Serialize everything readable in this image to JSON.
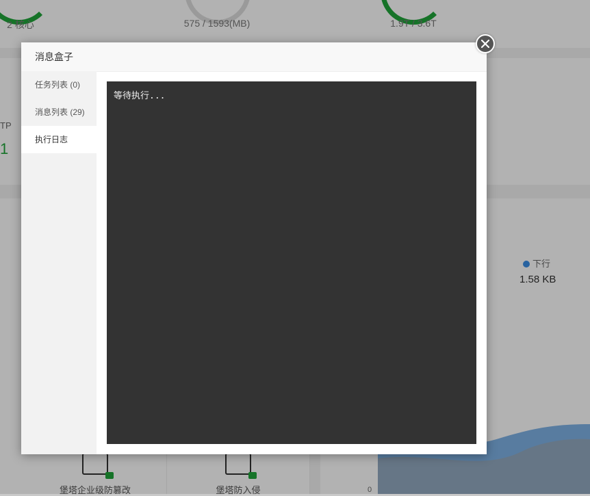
{
  "background": {
    "cpu_label": "2 核心",
    "memory_label": "575 / 1593(MB)",
    "disk_label": "1.9T / 3.6T",
    "partial_left_label": "TP",
    "partial_left_value": "1",
    "legend_down_label": "下行",
    "down_value": "1.58 KB",
    "feature1_label": "堡塔企业级防篡改",
    "feature2_label": "堡塔防入侵",
    "chart_axis_zero": "0",
    "colors": {
      "accent_green": "#20a53a",
      "series_blue": "#3a8ee6"
    }
  },
  "modal": {
    "title": "消息盒子",
    "close_icon": "close-icon",
    "sidebar": {
      "items": [
        {
          "label": "任务列表 (0)",
          "active": false
        },
        {
          "label": "消息列表 (29)",
          "active": false
        },
        {
          "label": "执行日志",
          "active": true
        }
      ]
    },
    "log_text": "等待执行..."
  }
}
